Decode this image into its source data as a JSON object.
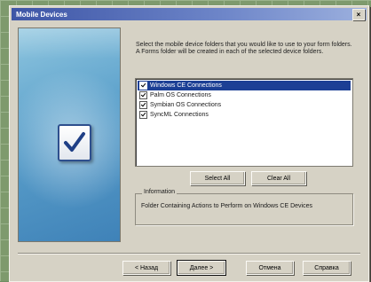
{
  "dialog": {
    "title": "Mobile Devices",
    "close_glyph": "×",
    "instructions": "Select the mobile device folders that you would like to use to your form folders. A Forms folder will be created in each of the selected device folders.",
    "devices": [
      {
        "label": "Windows CE Connections",
        "checked": true,
        "selected": true
      },
      {
        "label": "Palm OS Connections",
        "checked": true,
        "selected": false
      },
      {
        "label": "Symbian OS Connections",
        "checked": true,
        "selected": false
      },
      {
        "label": "SyncML Connections",
        "checked": true,
        "selected": false
      }
    ],
    "select_all_label": "Select All",
    "clear_all_label": "Clear All",
    "info_heading": "Information",
    "info_text": "Folder Containing Actions to Perform on Windows CE Devices",
    "back_label": "< Назад",
    "next_label": "Далее >",
    "cancel_label": "Отмена",
    "help_label": "Справка"
  },
  "icons": {
    "close": "close-icon",
    "checkmark": "checkmark-icon"
  },
  "colors": {
    "title_bar": "#3d55a6",
    "selection": "#1c3f95",
    "side_panel": "#5ba0cb"
  }
}
